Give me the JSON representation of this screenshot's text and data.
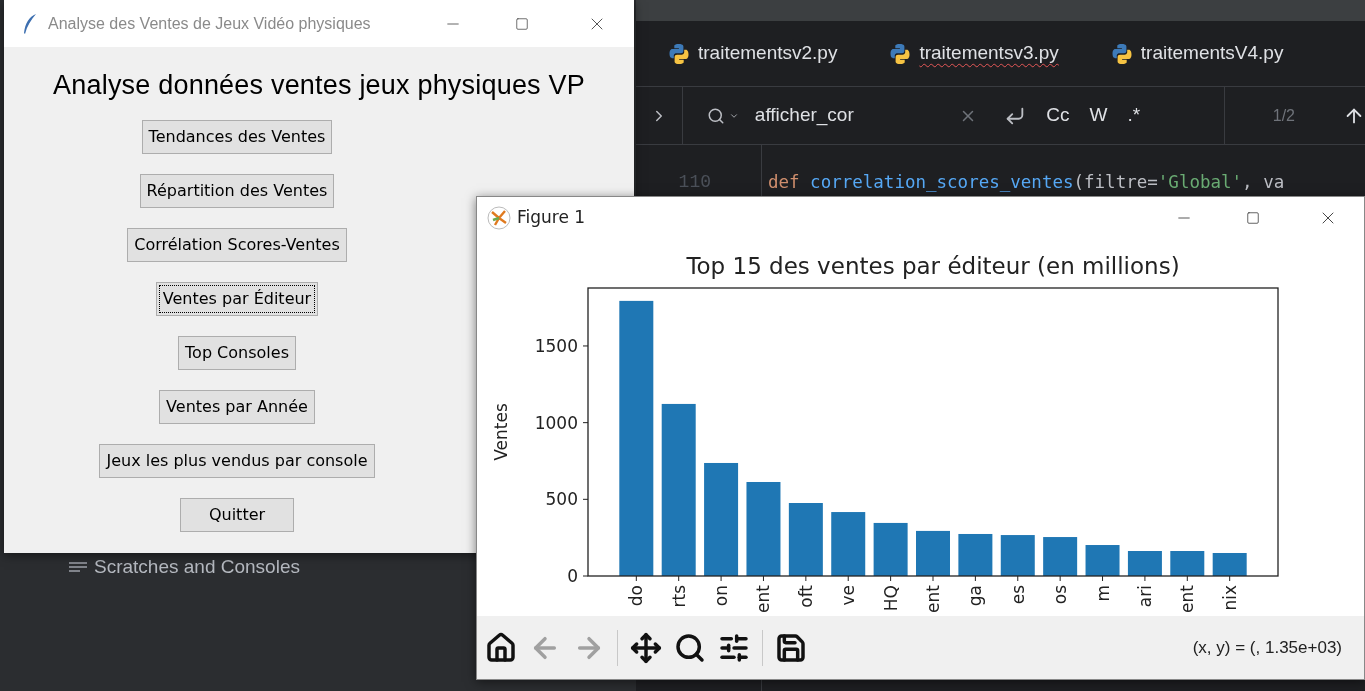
{
  "ide": {
    "tabs": [
      {
        "label": "traitementsv2.py",
        "error": false
      },
      {
        "label": "traitementsv3.py",
        "error": true
      },
      {
        "label": "traitementsV4.py",
        "error": false
      }
    ],
    "find": {
      "value": "afficher_cor",
      "options": [
        "Cc",
        "W",
        ".*"
      ],
      "count": "1/2"
    },
    "code": [
      {
        "line": "110",
        "tokens": [
          {
            "kind": "keyword",
            "text": "def"
          },
          {
            "kind": "function",
            "text": "correlation_scores_ventes"
          },
          {
            "kind": "plain",
            "text": "(filtre="
          },
          {
            "kind": "string",
            "text": "'Global'"
          },
          {
            "kind": "plain",
            "text": ", va"
          }
        ]
      }
    ],
    "project_item": "Scratches and Consoles"
  },
  "app_window": {
    "title": "Analyse des Ventes de Jeux Vidéo physiques",
    "heading": "Analyse données ventes jeux physiques VP",
    "buttons": [
      {
        "label": "Tendances des Ventes",
        "focused": false
      },
      {
        "label": "Répartition des Ventes",
        "focused": false
      },
      {
        "label": "Corrélation Scores-Ventes",
        "focused": false
      },
      {
        "label": "Ventes par Éditeur",
        "focused": true
      },
      {
        "label": "Top Consoles",
        "focused": false
      },
      {
        "label": "Ventes par Année",
        "focused": false
      },
      {
        "label": "Jeux les plus vendus par console",
        "focused": false
      },
      {
        "label": "Quitter",
        "focused": false
      }
    ]
  },
  "figure_window": {
    "title": "Figure 1",
    "chart_data": {
      "type": "bar",
      "title": "Top 15 des ventes par éditeur (en millions)",
      "ylabel": "Ventes",
      "categories": [
        "do",
        "rts",
        "on",
        "ent",
        "oft",
        "ve",
        "HQ",
        "ent",
        "ga",
        "es",
        "os",
        "m",
        "ari",
        "ent",
        "nix"
      ],
      "values": [
        1794,
        1122,
        737,
        613,
        476,
        417,
        346,
        294,
        274,
        267,
        254,
        202,
        163,
        163,
        150
      ],
      "ylim": [
        0,
        1878
      ],
      "yticks": [
        0,
        500,
        1000,
        1500
      ]
    },
    "toolbar": [
      {
        "kind": "home",
        "disabled": false
      },
      {
        "kind": "back",
        "disabled": true
      },
      {
        "kind": "forward",
        "disabled": true
      },
      {
        "kind": "separator"
      },
      {
        "kind": "pan",
        "disabled": false
      },
      {
        "kind": "zoom",
        "disabled": false
      },
      {
        "kind": "configure",
        "disabled": false
      },
      {
        "kind": "separator"
      },
      {
        "kind": "save",
        "disabled": false
      }
    ],
    "coords": "(x, y) = (, 1.35e+03)"
  }
}
